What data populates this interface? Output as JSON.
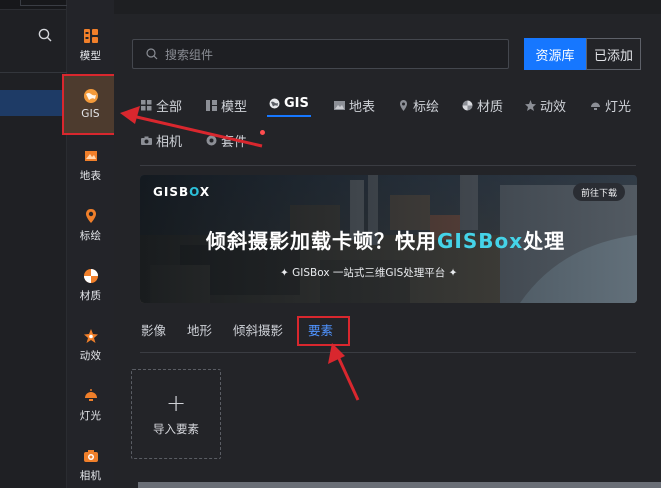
{
  "left_panel": {
    "search_icon": "search-icon"
  },
  "rail": {
    "items": [
      {
        "label": "模型",
        "icon": "model-icon"
      },
      {
        "label": "GIS",
        "icon": "gis-globe-icon"
      },
      {
        "label": "地表",
        "icon": "terrain-icon"
      },
      {
        "label": "标绘",
        "icon": "map-pin-icon"
      },
      {
        "label": "材质",
        "icon": "material-ball-icon"
      },
      {
        "label": "动效",
        "icon": "effect-star-icon"
      },
      {
        "label": "灯光",
        "icon": "lamp-icon"
      },
      {
        "label": "相机",
        "icon": "camera-icon"
      }
    ]
  },
  "search": {
    "placeholder": "搜索组件"
  },
  "tabs": {
    "source": "资源库",
    "added": "已添加"
  },
  "categories": [
    {
      "label": "全部",
      "icon": "grid-icon"
    },
    {
      "label": "模型",
      "icon": "model-icon"
    },
    {
      "label": "GIS",
      "icon": "gis-globe-icon",
      "active": true
    },
    {
      "label": "地表",
      "icon": "terrain-icon"
    },
    {
      "label": "标绘",
      "icon": "map-pin-icon"
    },
    {
      "label": "材质",
      "icon": "material-ball-icon"
    },
    {
      "label": "动效",
      "icon": "effect-star-icon"
    },
    {
      "label": "灯光",
      "icon": "lamp-icon"
    },
    {
      "label": "相机",
      "icon": "camera-icon"
    },
    {
      "label": "套件",
      "icon": "kit-icon"
    }
  ],
  "banner": {
    "brand_a": "GISB",
    "brand_x": "O",
    "brand_b": "X",
    "download_label": "前往下载",
    "title_prefix": "倾斜摄影加载卡顿？快用",
    "title_highlight": "GISBox",
    "title_suffix": "处理",
    "subtitle": "✦  GISBox  一站式三维GIS处理平台  ✦"
  },
  "subtabs": [
    {
      "label": "影像"
    },
    {
      "label": "地形"
    },
    {
      "label": "倾斜摄影"
    },
    {
      "label": "要素",
      "active": true
    }
  ],
  "import": {
    "label": "导入要素"
  },
  "colors": {
    "accent": "#1677ff",
    "highlight_red": "#d9272e",
    "banner_cyan": "#45d3e8"
  }
}
